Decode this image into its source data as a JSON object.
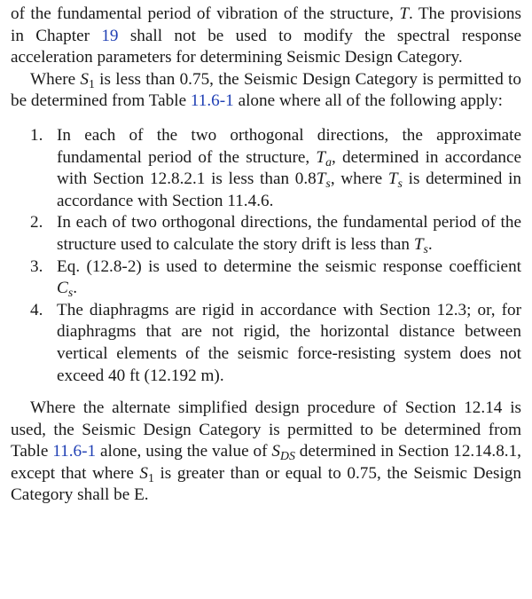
{
  "para1": {
    "t1": "of the fundamental period of vibration of the structure, ",
    "T": "T",
    "t2": ". The provisions in Chapter ",
    "ch_link": "19",
    "t3": " shall not be used to modify the spectral response acceleration parameters for determining Seismic Design Category."
  },
  "para2": {
    "t1": "Where ",
    "S": "S",
    "S_sub": "1",
    "t2": " is less than 0.75, the Seismic Design Category is permitted to be determined from Table ",
    "table_link": "11.6-1",
    "t3": " alone where all of the following apply:"
  },
  "list": {
    "item1": {
      "num": "1.",
      "t1": "In each of the two orthogonal directions, the approximate fundamental period of the structure, ",
      "Ta": "T",
      "Ta_sub": "a",
      "t2": ", determined in accordance with Section 12.8.2.1 is less than 0.8",
      "Ts": "T",
      "Ts_sub": "s",
      "t3": ", where ",
      "Ts2": "T",
      "Ts2_sub": "s",
      "t4": " is determined in accordance with Section 11.4.6."
    },
    "item2": {
      "num": "2.",
      "t1": "In each of two orthogonal directions, the fundamental period of the structure used to calculate the story drift is less than ",
      "Ts": "T",
      "Ts_sub": "s",
      "t2": "."
    },
    "item3": {
      "num": "3.",
      "t1": "Eq. (12.8-2) is used to determine the seismic response coefficient ",
      "Cs": "C",
      "Cs_sub": "s",
      "t2": "."
    },
    "item4": {
      "num": "4.",
      "t1": "The diaphragms are rigid in accordance with Section 12.3; or, for diaphragms that are not rigid, the horizontal distance between vertical elements of the seismic force-resisting system does not exceed 40 ft (12.192 m)."
    }
  },
  "para3": {
    "t1": "Where the alternate simplified design procedure of Section 12.14 is used, the Seismic Design Category is permitted to be determined from Table ",
    "table_link": "11.6-1",
    "t2": " alone, using the value of ",
    "Sds": "S",
    "Sds_sub": "DS",
    "t3": " determined in Section 12.14.8.1, except that where ",
    "S1": "S",
    "S1_sub": "1",
    "t4": " is greater than or equal to 0.75, the Seismic Design Category shall be E."
  }
}
